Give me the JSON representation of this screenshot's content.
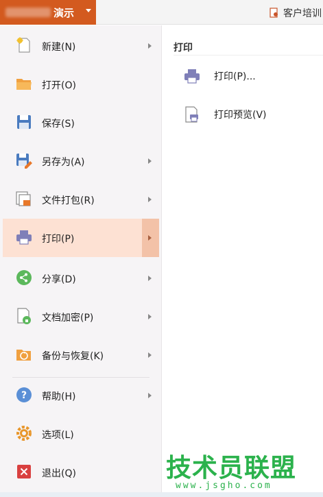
{
  "app": {
    "title": "演示",
    "client_link": "客户培训"
  },
  "menu": {
    "items": [
      {
        "id": "new",
        "label": "新建(N)",
        "has_submenu": true
      },
      {
        "id": "open",
        "label": "打开(O)",
        "has_submenu": false
      },
      {
        "id": "save",
        "label": "保存(S)",
        "has_submenu": false
      },
      {
        "id": "save-as",
        "label": "另存为(A)",
        "has_submenu": true
      },
      {
        "id": "package",
        "label": "文件打包(R)",
        "has_submenu": true
      },
      {
        "id": "print",
        "label": "打印(P)",
        "has_submenu": true,
        "active": true
      },
      {
        "id": "share",
        "label": "分享(D)",
        "has_submenu": true
      },
      {
        "id": "encrypt",
        "label": "文档加密(P)",
        "has_submenu": true
      },
      {
        "id": "backup",
        "label": "备份与恢复(K)",
        "has_submenu": true
      },
      {
        "id": "help",
        "label": "帮助(H)",
        "has_submenu": true
      },
      {
        "id": "options",
        "label": "选项(L)",
        "has_submenu": false
      },
      {
        "id": "exit",
        "label": "退出(Q)",
        "has_submenu": false
      }
    ]
  },
  "panel": {
    "title": "打印",
    "items": [
      {
        "id": "print",
        "label": "打印(P)..."
      },
      {
        "id": "print-preview",
        "label": "打印预览(V)"
      }
    ]
  },
  "watermark": {
    "title": "技术员联盟",
    "url": "www.jsgho.com"
  },
  "colors": {
    "accent": "#d35a1f",
    "menu_bg": "#f6f4f6",
    "active_bg": "#fde1d3",
    "active_arrow_bg": "#f3c2a8",
    "watermark": "#2bb24c"
  }
}
